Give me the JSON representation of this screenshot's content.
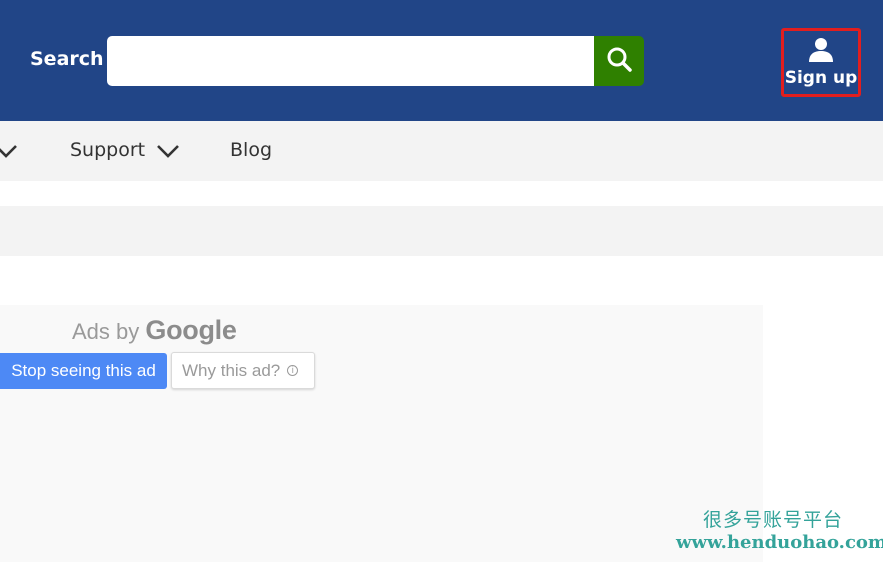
{
  "header": {
    "search_label": "Search",
    "search_value": "",
    "search_button_icon": "search-icon",
    "signup_label": "Sign up",
    "signup_icon": "user-icon",
    "colors": {
      "background": "#214587",
      "search_button": "#2f8000",
      "signup_highlight": "#e21e1e"
    }
  },
  "nav": {
    "items": [
      {
        "label": "",
        "has_dropdown": true
      },
      {
        "label": "Support",
        "has_dropdown": true
      },
      {
        "label": "Blog",
        "has_dropdown": false
      }
    ]
  },
  "ad": {
    "ads_by_prefix": "Ads by",
    "ads_by_brand": "Google",
    "stop_label": "Stop seeing this ad",
    "why_label": "Why this ad?",
    "why_icon": "info-icon",
    "colors": {
      "stop_button": "#4d89f5"
    }
  },
  "watermark": {
    "cn_text": "很多号账号平台",
    "url": "www.henduohao.com",
    "color": "#34a39a"
  }
}
